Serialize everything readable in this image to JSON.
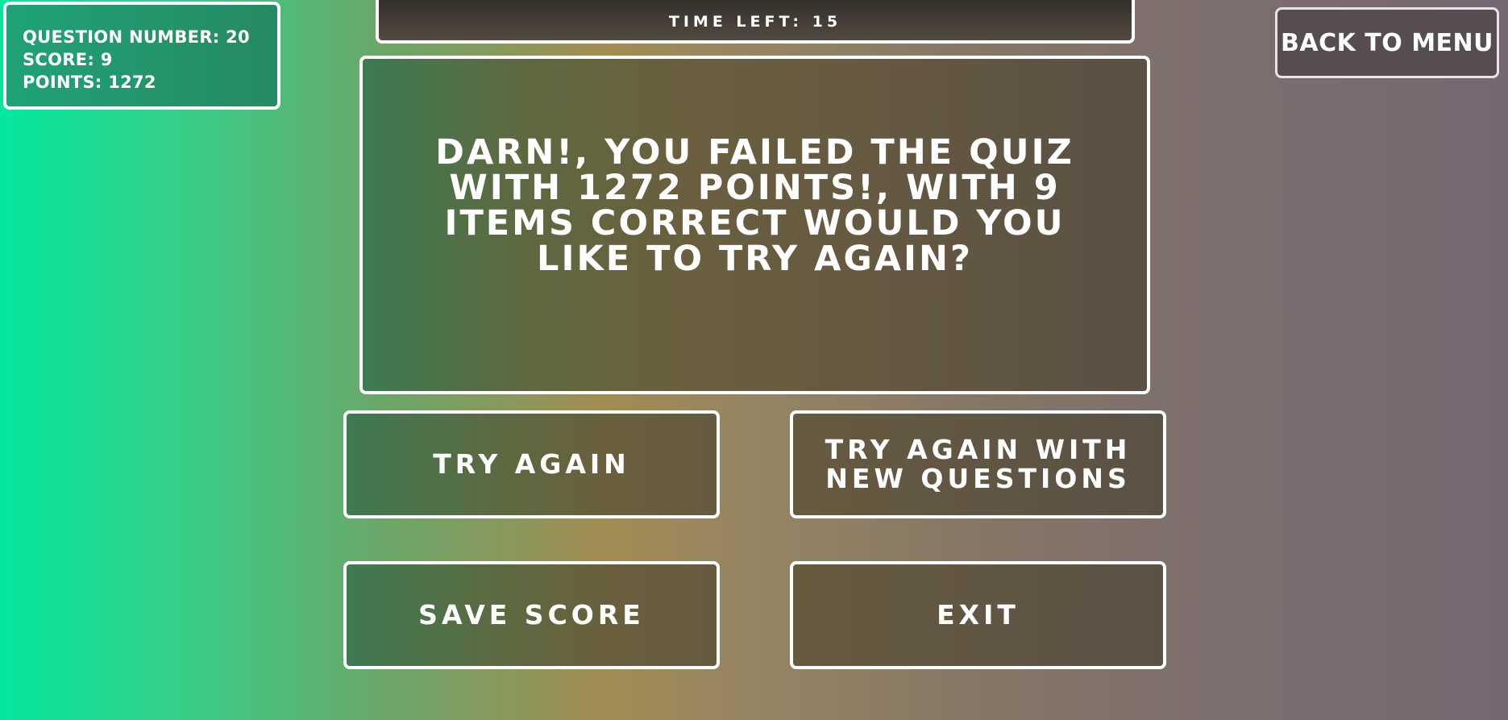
{
  "hud": {
    "question_number": "Question Number: 20",
    "score": "Score: 9",
    "points": "Points: 1272"
  },
  "timer": {
    "text": "Time left: 15"
  },
  "menu": {
    "back_label": "Back to Menu"
  },
  "result": {
    "message": "Darn!, you failed the quiz with 1272 points!, with 9 items correct would you like to try again?"
  },
  "actions": {
    "try_again": "Try Again",
    "try_again_new": "Try again with new questions",
    "save_score": "Save Score",
    "exit": "Exit"
  },
  "colors": {
    "background_left": "#04e79e",
    "background_mid": "#a28c52",
    "background_right": "#766872",
    "border": "#ffffff"
  }
}
